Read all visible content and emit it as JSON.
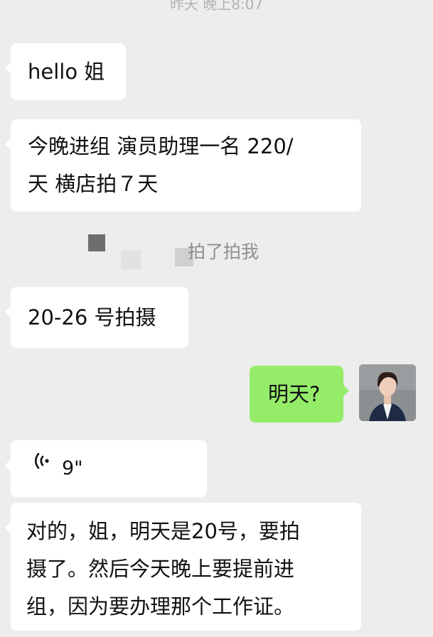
{
  "timestamp": "昨天 晚上8:07",
  "messages": [
    {
      "text": "hello 姐"
    },
    {
      "text_line1": "今晚进组 演员助理一名 220/",
      "text_line2": "天 横店拍７天"
    },
    {
      "text": "20-26 号拍摄"
    },
    {
      "text": "明天?"
    },
    {
      "duration": "9\""
    },
    {
      "text_line1": "对的，姐，明天是20号，要拍",
      "text_line2": "摄了。然后今天晚上要提前进",
      "text_line3": "组，因为要办理那个工作证。"
    }
  ],
  "system_notice": "拍了拍我",
  "icons": {
    "voice": "voice-wave-icon",
    "avatar": "user-avatar"
  },
  "colors": {
    "background": "#ededed",
    "incoming_bubble": "#ffffff",
    "outgoing_bubble": "#95ec69"
  }
}
